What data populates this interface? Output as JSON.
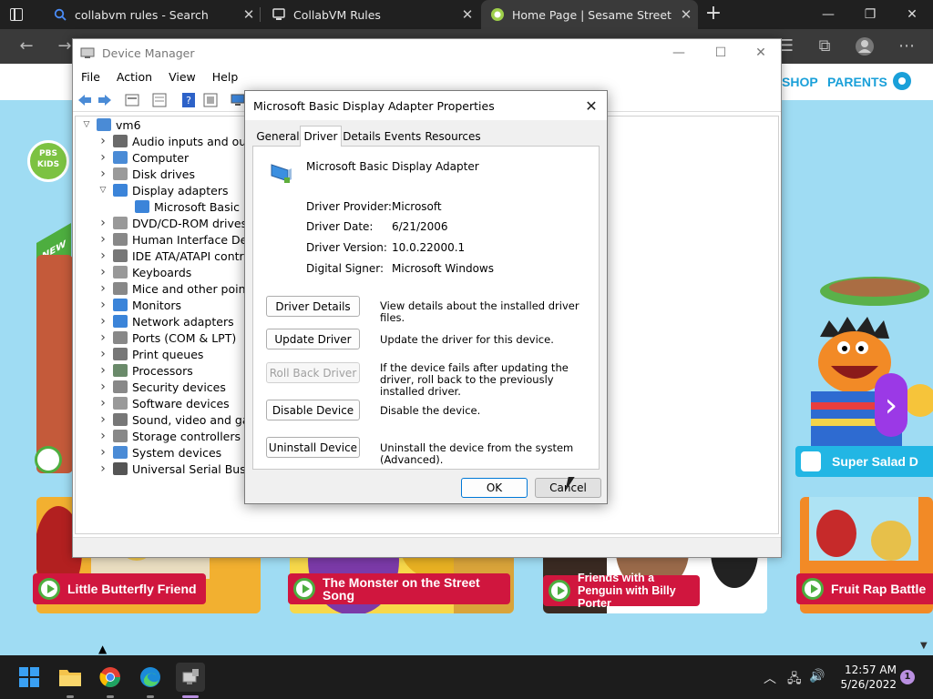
{
  "browser": {
    "tabs": [
      {
        "title": "collabvm rules - Search",
        "icon": "search-icon"
      },
      {
        "title": "CollabVM Rules",
        "icon": "collabvm-icon"
      },
      {
        "title": "Home Page | Sesame Street | PBS",
        "icon": "sesame-icon",
        "active": true
      }
    ],
    "new_tab": "+"
  },
  "webpage": {
    "nav": [
      "SHOP",
      "PARENTS"
    ],
    "logo_text": "PBS KIDS",
    "badge_new": "NEW",
    "featured_label": "Super Salad D",
    "cards": [
      {
        "label": "Little Butterfly Friend"
      },
      {
        "label": "The Monster on the Street Song"
      },
      {
        "label": "Friends with a Penguin with Billy Porter"
      },
      {
        "label": "Fruit Rap Battle"
      }
    ],
    "colors": {
      "brand_blue": "#1aa0d9",
      "card_red": "#d0163e",
      "play_green": "#4dae3f",
      "accent_purple": "#9b39e6"
    }
  },
  "device_manager": {
    "title": "Device Manager",
    "menu": [
      "File",
      "Action",
      "View",
      "Help"
    ],
    "root": "vm6",
    "tree": [
      {
        "label": "Audio inputs and outpu",
        "expanded": false
      },
      {
        "label": "Computer",
        "expanded": false
      },
      {
        "label": "Disk drives",
        "expanded": false
      },
      {
        "label": "Display adapters",
        "expanded": true
      },
      {
        "label": "Microsoft Basic Disp",
        "child": true
      },
      {
        "label": "DVD/CD-ROM drives",
        "expanded": false
      },
      {
        "label": "Human Interface Device",
        "expanded": false
      },
      {
        "label": "IDE ATA/ATAPI controlle",
        "expanded": false
      },
      {
        "label": "Keyboards",
        "expanded": false
      },
      {
        "label": "Mice and other pointing",
        "expanded": false
      },
      {
        "label": "Monitors",
        "expanded": false
      },
      {
        "label": "Network adapters",
        "expanded": false
      },
      {
        "label": "Ports (COM & LPT)",
        "expanded": false
      },
      {
        "label": "Print queues",
        "expanded": false
      },
      {
        "label": "Processors",
        "expanded": false
      },
      {
        "label": "Security devices",
        "expanded": false
      },
      {
        "label": "Software devices",
        "expanded": false
      },
      {
        "label": "Sound, video and game",
        "expanded": false
      },
      {
        "label": "Storage controllers",
        "expanded": false
      },
      {
        "label": "System devices",
        "expanded": false
      },
      {
        "label": "Universal Serial Bus cont",
        "expanded": false
      }
    ]
  },
  "dialog": {
    "title": "Microsoft Basic Display Adapter Properties",
    "tabs": [
      "General",
      "Driver",
      "Details",
      "Events",
      "Resources"
    ],
    "active_tab": "Driver",
    "device_name": "Microsoft Basic Display Adapter",
    "fields": [
      {
        "label": "Driver Provider:",
        "value": "Microsoft"
      },
      {
        "label": "Driver Date:",
        "value": "6/21/2006"
      },
      {
        "label": "Driver Version:",
        "value": "10.0.22000.1"
      },
      {
        "label": "Digital Signer:",
        "value": "Microsoft Windows"
      }
    ],
    "actions": [
      {
        "label": "Driver Details",
        "desc": "View details about the installed driver files.",
        "enabled": true
      },
      {
        "label": "Update Driver",
        "desc": "Update the driver for this device.",
        "enabled": true
      },
      {
        "label": "Roll Back Driver",
        "desc": "If the device fails after updating the driver, roll back to the previously installed driver.",
        "enabled": false
      },
      {
        "label": "Disable Device",
        "desc": "Disable the device.",
        "enabled": true
      },
      {
        "label": "Uninstall Device",
        "desc": "Uninstall the device from the system (Advanced).",
        "enabled": true
      }
    ],
    "ok": "OK",
    "cancel": "Cancel"
  },
  "taskbar": {
    "time": "12:57 AM",
    "date": "5/26/2022",
    "notifications": "1",
    "apps": [
      "start-icon",
      "file-explorer-icon",
      "chrome-icon",
      "edge-icon",
      "device-manager-icon"
    ]
  }
}
